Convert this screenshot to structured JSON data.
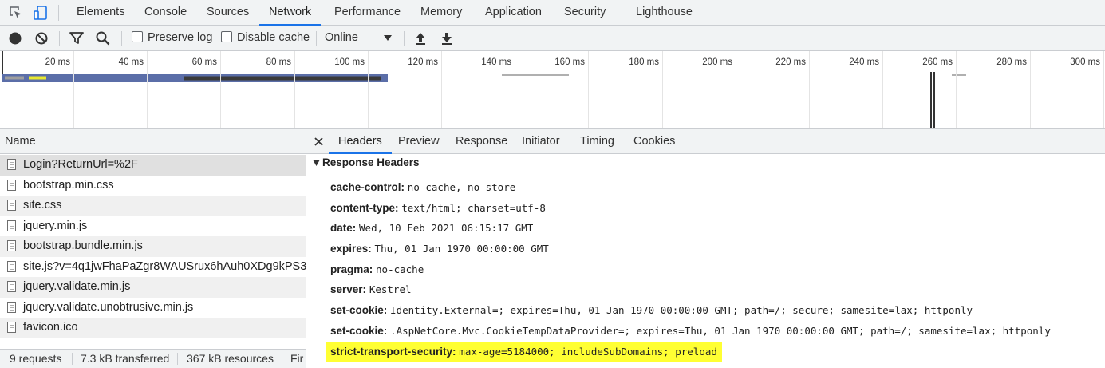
{
  "main_tabs": [
    "Elements",
    "Console",
    "Sources",
    "Network",
    "Performance",
    "Memory",
    "Application",
    "Security",
    "Lighthouse"
  ],
  "active_main_tab": "Network",
  "toolbar": {
    "preserve_log_label": "Preserve log",
    "preserve_log_checked": false,
    "disable_cache_label": "Disable cache",
    "disable_cache_checked": false,
    "throttle_value": "Online"
  },
  "overview": {
    "ticks": [
      "20 ms",
      "40 ms",
      "60 ms",
      "80 ms",
      "100 ms",
      "120 ms",
      "140 ms",
      "160 ms",
      "180 ms",
      "200 ms",
      "220 ms",
      "240 ms",
      "260 ms",
      "280 ms",
      "300 ms"
    ]
  },
  "request_list": {
    "header": "Name",
    "rows": [
      "Login?ReturnUrl=%2F",
      "bootstrap.min.css",
      "site.css",
      "jquery.min.js",
      "bootstrap.bundle.min.js",
      "site.js?v=4q1jwFhaPaZgr8WAUSrux6hAuh0XDg9kPS3...",
      "jquery.validate.min.js",
      "jquery.validate.unobtrusive.min.js",
      "favicon.ico"
    ],
    "selected_index": 0
  },
  "status": {
    "requests": "9 requests",
    "transferred": "7.3 kB transferred",
    "resources": "367 kB resources",
    "finish": "Fir"
  },
  "detail_tabs": [
    "Headers",
    "Preview",
    "Response",
    "Initiator",
    "Timing",
    "Cookies"
  ],
  "active_detail_tab": "Headers",
  "response_headers": {
    "title": "Response Headers",
    "items": [
      {
        "name": "cache-control:",
        "value": "no-cache, no-store"
      },
      {
        "name": "content-type:",
        "value": "text/html; charset=utf-8"
      },
      {
        "name": "date:",
        "value": "Wed, 10 Feb 2021 06:15:17 GMT"
      },
      {
        "name": "expires:",
        "value": "Thu, 01 Jan 1970 00:00:00 GMT"
      },
      {
        "name": "pragma:",
        "value": "no-cache"
      },
      {
        "name": "server:",
        "value": "Kestrel"
      },
      {
        "name": "set-cookie:",
        "value": "Identity.External=; expires=Thu, 01 Jan 1970 00:00:00 GMT; path=/; secure; samesite=lax; httponly"
      },
      {
        "name": "set-cookie:",
        "value": ".AspNetCore.Mvc.CookieTempDataProvider=; expires=Thu, 01 Jan 1970 00:00:00 GMT; path=/; samesite=lax; httponly"
      },
      {
        "name": "strict-transport-security:",
        "value": "max-age=5184000; includeSubDomains; preload"
      }
    ],
    "highlighted_index": 8,
    "highlight_color": "#ffff33"
  },
  "colors": {
    "accent": "#1a73e8",
    "toolbar_bg": "#f1f3f4",
    "border": "#cacdd1",
    "timeline_blue": "#5b6ea8"
  },
  "icons": [
    "inspect-element-icon",
    "device-toolbar-icon",
    "record-icon",
    "clear-icon",
    "filter-icon",
    "search-icon",
    "dropdown-caret-icon",
    "upload-icon",
    "download-icon",
    "close-icon",
    "collapse-triangle-icon",
    "file-icon"
  ]
}
